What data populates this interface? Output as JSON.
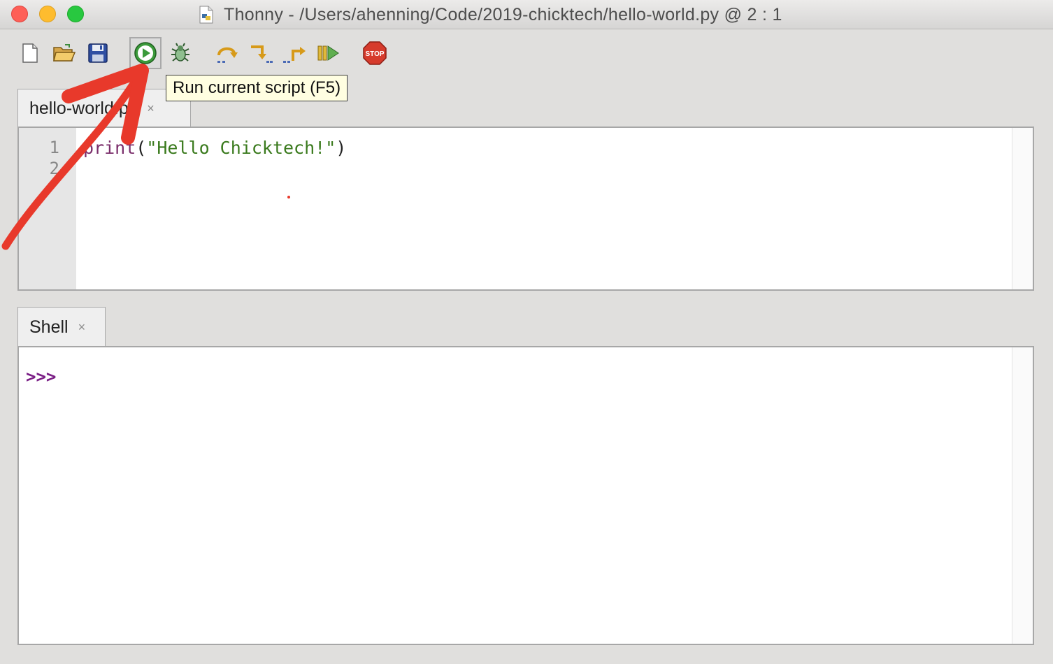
{
  "window": {
    "title": "Thonny  -  /Users/ahenning/Code/2019-chicktech/hello-world.py  @  2 : 1",
    "doc_icon": "python-file-icon"
  },
  "toolbar": {
    "buttons": [
      {
        "name": "new-file",
        "icon": "new-file-icon"
      },
      {
        "name": "open-file",
        "icon": "open-folder-icon"
      },
      {
        "name": "save-file",
        "icon": "save-disk-icon"
      },
      {
        "name": "run",
        "icon": "run-play-icon",
        "active": true
      },
      {
        "name": "debug",
        "icon": "bug-icon"
      },
      {
        "name": "step-over",
        "icon": "step-over-icon"
      },
      {
        "name": "step-into",
        "icon": "step-into-icon"
      },
      {
        "name": "step-out",
        "icon": "step-out-icon"
      },
      {
        "name": "resume",
        "icon": "resume-icon"
      },
      {
        "name": "stop",
        "icon": "stop-sign-icon",
        "label": "STOP"
      }
    ],
    "tooltip": "Run current script (F5)"
  },
  "editor": {
    "tab_label": "hello-world.py",
    "close_glyph": "×",
    "line_numbers": [
      "1",
      "2"
    ],
    "code": {
      "fn": "print",
      "open": "(",
      "string": "\"Hello Chicktech!\"",
      "close": ")"
    }
  },
  "shell": {
    "tab_label": "Shell",
    "close_glyph": "×",
    "prompt": ">>>"
  },
  "colors": {
    "annotation_arrow": "#e8392b",
    "keyword": "#7b2e6b",
    "string": "#3a7a1d",
    "prompt": "#7b1f86"
  }
}
